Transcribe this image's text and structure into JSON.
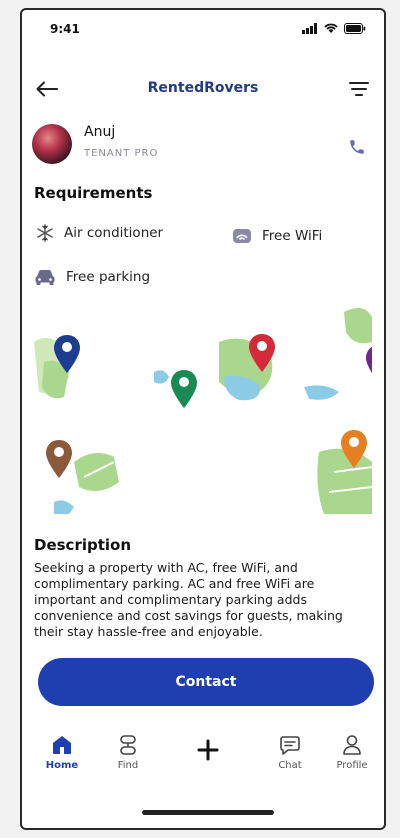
{
  "status_bar": {
    "time": "9:41"
  },
  "header": {
    "title": "RentedRovers"
  },
  "user": {
    "name": "Anuj",
    "role": "TENANT PRO"
  },
  "requirements": {
    "title": "Requirements",
    "items": [
      {
        "label": "Air conditioner",
        "icon": "snowflake-icon"
      },
      {
        "label": "Free WiFi",
        "icon": "router-icon"
      },
      {
        "label": "Free parking",
        "icon": "car-icon"
      }
    ]
  },
  "description": {
    "title": "Description",
    "text": "Seeking a property with AC, free WiFi, and complimentary parking. AC and free WiFi are important  and complimentary parking adds convenience and cost savings for guests, making their stay hassle-free and enjoyable."
  },
  "contact": {
    "label": "Contact"
  },
  "tabs": [
    {
      "label": "Home",
      "active": true
    },
    {
      "label": "Find"
    },
    {
      "label": ""
    },
    {
      "label": "Chat"
    },
    {
      "label": "Profile"
    }
  ],
  "colors": {
    "accent": "#1f3fb0",
    "title": "#1f3a8a",
    "pin_red": "#d62a3a",
    "pin_blue": "#1d3d8f",
    "pin_green": "#1a8a55",
    "pin_orange": "#e67e22",
    "pin_brown": "#8a5a3a",
    "pin_purple": "#6a2a8a"
  }
}
